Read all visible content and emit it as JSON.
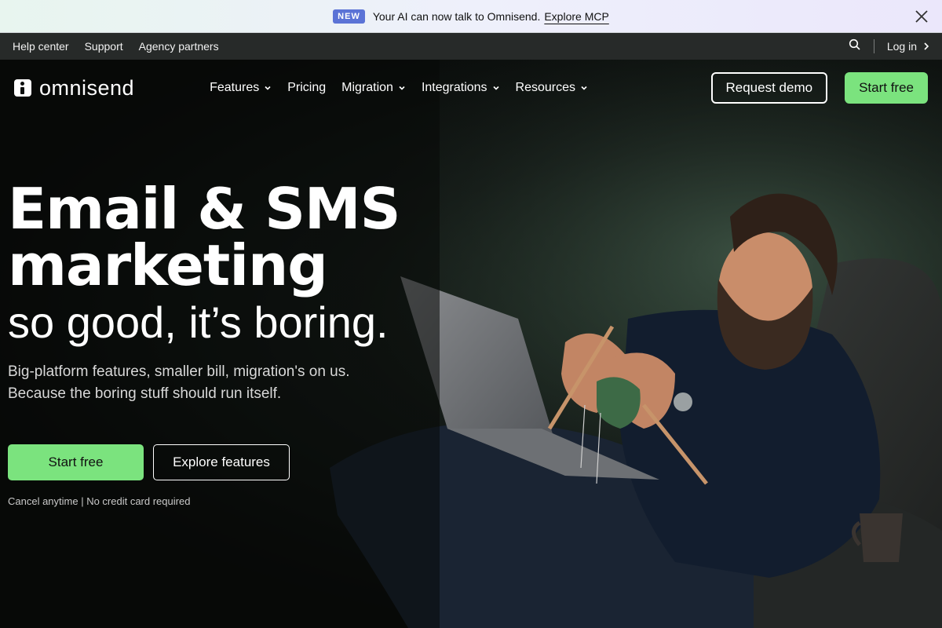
{
  "announcement": {
    "badge": "NEW",
    "text": "Your AI can now talk to Omnisend.",
    "link": "Explore MCP",
    "close_icon": "close-icon"
  },
  "utility_bar": {
    "links": [
      "Help center",
      "Support",
      "Agency partners"
    ],
    "search_icon": "search-icon",
    "login": "Log in"
  },
  "nav": {
    "logo": "omnisend",
    "menu": [
      {
        "label": "Features",
        "has_dropdown": true
      },
      {
        "label": "Pricing",
        "has_dropdown": false
      },
      {
        "label": "Migration",
        "has_dropdown": true
      },
      {
        "label": "Integrations",
        "has_dropdown": true
      },
      {
        "label": "Resources",
        "has_dropdown": true
      }
    ],
    "request_demo": "Request demo",
    "start_free": "Start free"
  },
  "hero": {
    "headline_line1": "Email & SMS",
    "headline_line2": "marketing",
    "subhead": "so good, it’s boring.",
    "lead_line1": "Big-platform features, smaller bill, migration's on us.",
    "lead_line2": "Because the boring stuff should run itself.",
    "cta_primary": "Start free",
    "cta_secondary": "Explore features",
    "fineprint": "Cancel anytime | No credit card required"
  },
  "colors": {
    "accent_green": "#7be37e",
    "badge_blue": "#5b73d6",
    "utility_bg": "#272a29"
  }
}
